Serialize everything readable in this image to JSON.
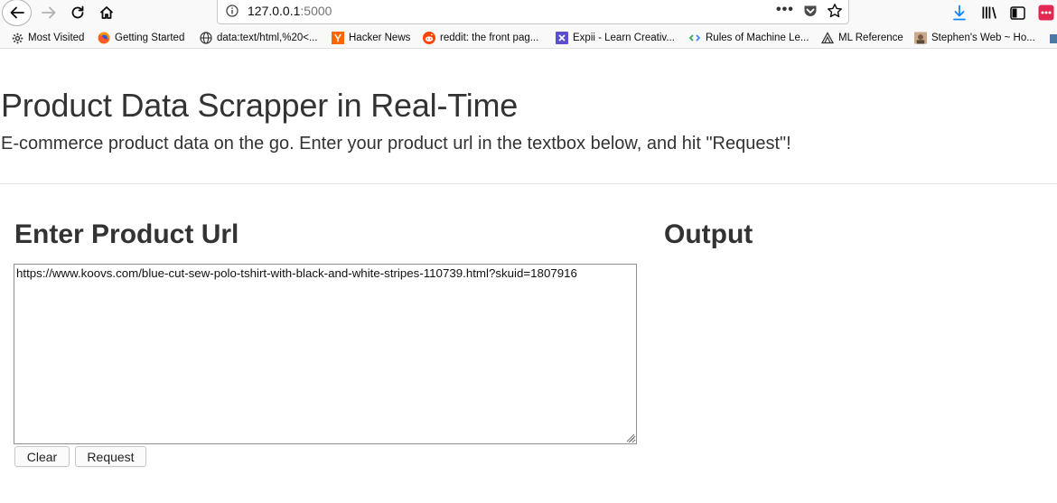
{
  "browser": {
    "url_host": "127.0.0.1",
    "url_port": ":5000",
    "more_label": "•••",
    "bookmarks": [
      {
        "label": "Most Visited",
        "icon": "gear-icon"
      },
      {
        "label": "Getting Started",
        "icon": "firefox-icon"
      },
      {
        "label": "data:text/html,%20<...",
        "icon": "globe-icon"
      },
      {
        "label": "Hacker News",
        "icon": "hacker-news-icon"
      },
      {
        "label": "reddit: the front pag...",
        "icon": "reddit-icon"
      },
      {
        "label": "Expii - Learn Creativ...",
        "icon": "expii-icon"
      },
      {
        "label": "Rules of Machine Le...",
        "icon": "google-icon"
      },
      {
        "label": "ML Reference",
        "icon": "ml-reference-icon"
      },
      {
        "label": "Stephen's Web ~ Ho...",
        "icon": "stephens-web-icon"
      }
    ]
  },
  "page": {
    "title": "Product Data Scrapper in Real-Time",
    "subtitle": "E-commerce product data on the go. Enter your product url in the textbox below, and hit \"Request\"!",
    "input_section": {
      "heading": "Enter Product Url",
      "textarea_value": "https://www.koovs.com/blue-cut-sew-polo-tshirt-with-black-and-white-stripes-110739.html?skuid=1807916"
    },
    "output_section": {
      "heading": "Output"
    },
    "buttons": {
      "clear_label": "Clear",
      "request_label": "Request"
    }
  },
  "colors": {
    "text": "#333333",
    "chrome_bg": "#f9f9fa",
    "download_blue": "#0a84ff",
    "hacker_news_orange": "#ff6600",
    "reddit_orange": "#ff4500",
    "expii_purple": "#5b4fcf",
    "ext_red": "#e22850"
  }
}
